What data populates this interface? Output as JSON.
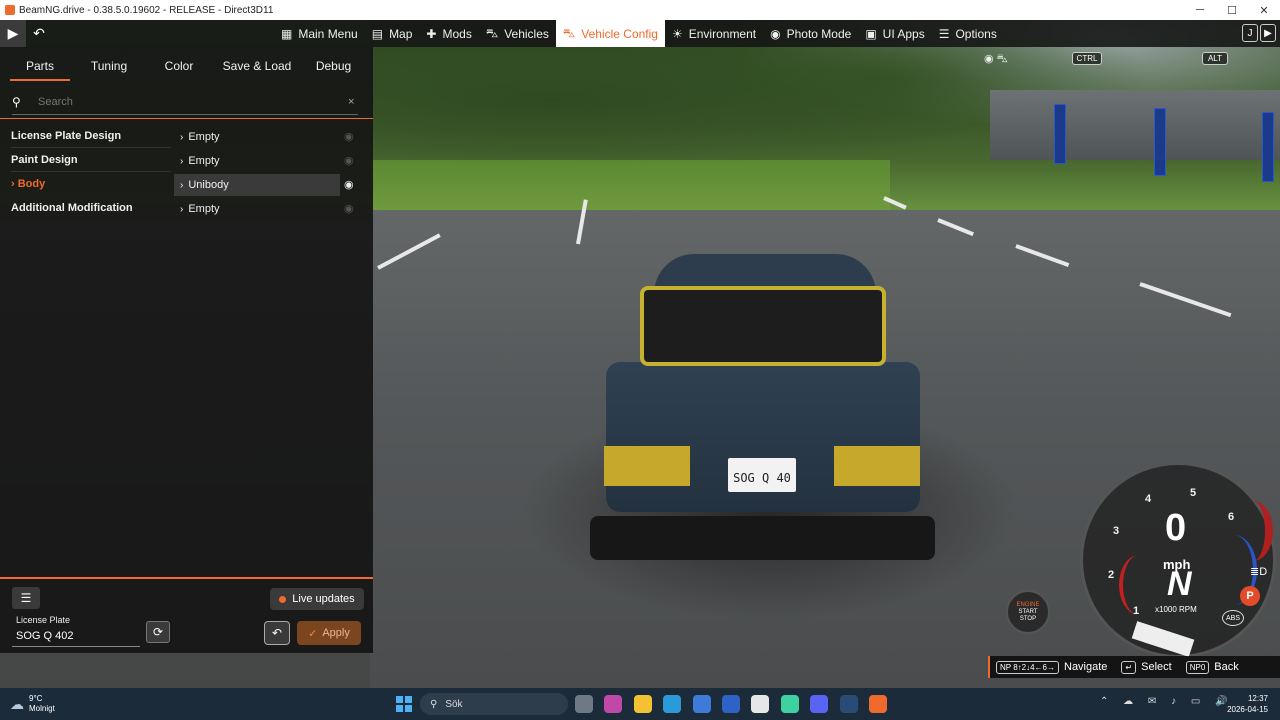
{
  "window": {
    "title": "BeamNG.drive - 0.38.5.0.19602 - RELEASE - Direct3D11",
    "controls": {
      "minimize": "─",
      "maximize": "☐",
      "close": "✕"
    }
  },
  "topbar": {
    "play_icon": "▶",
    "back_icon": "↶",
    "menu": [
      {
        "label": "Main Menu",
        "icon": "▦"
      },
      {
        "label": "Map",
        "icon": "▤"
      },
      {
        "label": "Mods",
        "icon": "✚"
      },
      {
        "label": "Vehicles",
        "icon": "⛍"
      },
      {
        "label": "Vehicle Config",
        "icon": "⛍",
        "active": true
      },
      {
        "label": "Environment",
        "icon": "☀"
      },
      {
        "label": "Photo Mode",
        "icon": "◉"
      },
      {
        "label": "UI Apps",
        "icon": "▣"
      },
      {
        "label": "Options",
        "icon": "☰"
      }
    ],
    "right_icons": [
      "J",
      "▶"
    ]
  },
  "panel": {
    "tabs": [
      "Parts",
      "Tuning",
      "Color",
      "Save & Load",
      "Debug"
    ],
    "active_tab": "Parts",
    "search": {
      "placeholder": "Search",
      "clear": "×",
      "icon": "search-icon"
    },
    "parts": [
      {
        "name": "License Plate Design",
        "value": "Empty",
        "active": false
      },
      {
        "name": "Paint Design",
        "value": "Empty",
        "active": false
      },
      {
        "name": "Body",
        "value": "Unibody",
        "active": true
      },
      {
        "name": "Additional Modification",
        "value": "Empty",
        "active": false
      }
    ],
    "body_chevron": "›",
    "value_chevron": "›",
    "eye_icon": "◉",
    "list_icon": "☰",
    "live_updates": "Live updates",
    "license_plate": {
      "label": "License Plate",
      "value": "SOG Q 402"
    },
    "randomize_icon": "⟳",
    "undo_icon": "↶",
    "apply": {
      "check": "✓",
      "label": "Apply"
    }
  },
  "scene": {
    "car_plate": "SOG Q 40"
  },
  "hud": {
    "ctrl": "CTRL",
    "alt": "ALT",
    "view_icons": "◉ ⛍",
    "gauge": {
      "ticks": [
        "1",
        "2",
        "3",
        "4",
        "5",
        "6"
      ],
      "speed": "0",
      "unit": "mph",
      "gear": "N",
      "rpm_label": "x1000 RPM",
      "redline_start": 6
    },
    "park": "P",
    "abs": "ABS",
    "lights_icon": "≣D",
    "engine": {
      "line1": "ENGINE",
      "line2": "START",
      "line3": "STOP"
    },
    "navbar": {
      "nav_key": "NP 8↑2↓4←6→",
      "navigate": "Navigate",
      "select_key": "↵",
      "select": "Select",
      "back_key": "NP0",
      "back": "Back"
    }
  },
  "taskbar": {
    "weather": {
      "temp": "9°C",
      "desc": "Molnigt"
    },
    "search_label": "Sök",
    "tray": "⌃ ☁ ✉ ♪ ▭ 🔊",
    "time": "12:37",
    "date": "2026-04-15",
    "app_colors": [
      "#6d7a86",
      "#c048a8",
      "#f2c233",
      "#2a9bd6",
      "#3e7ad9",
      "#2f62c7",
      "#e6e6e6",
      "#3fd2a0",
      "#5865f2",
      "#2a4b75",
      "#ef6a2c"
    ]
  }
}
